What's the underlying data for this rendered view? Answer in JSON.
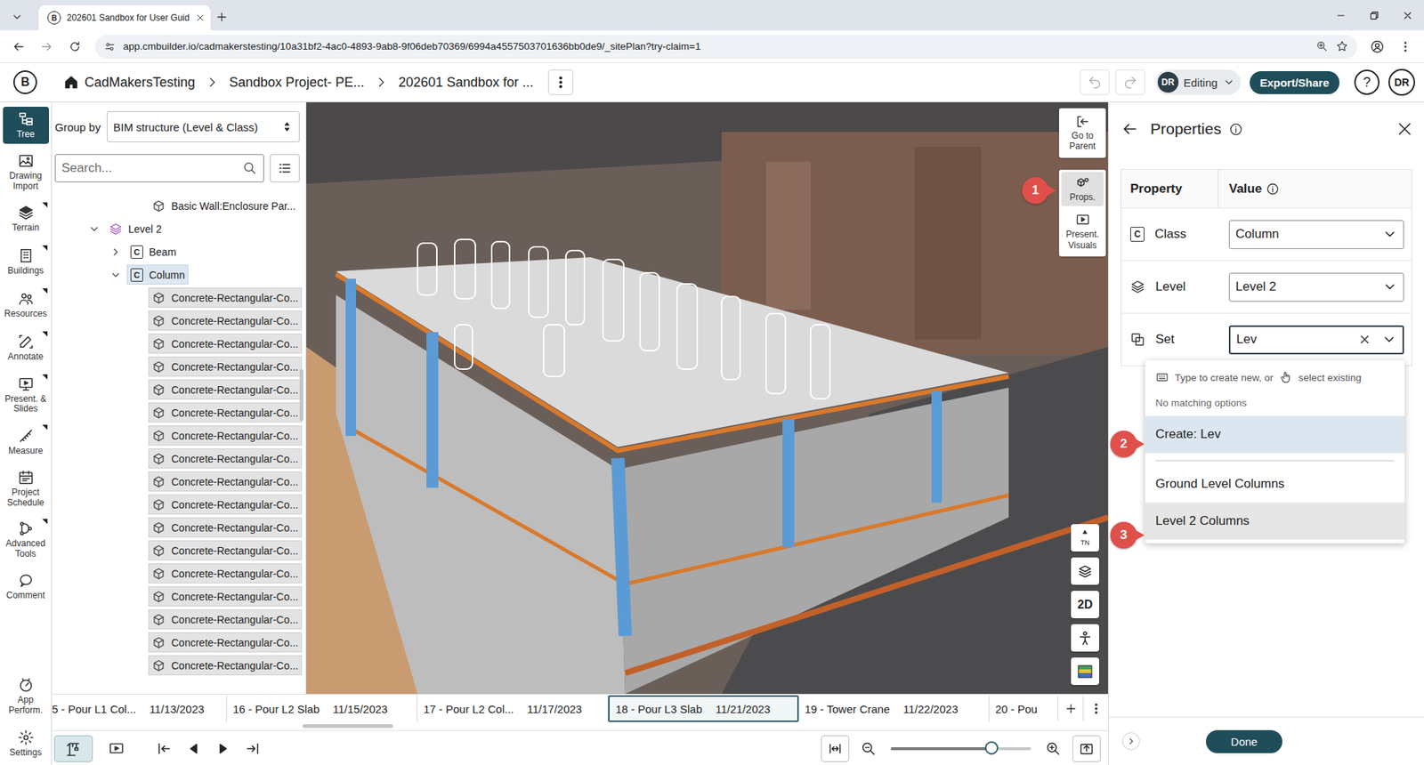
{
  "browser": {
    "favicon": "B",
    "tab_title": "202601 Sandbox for User Guid",
    "url": "app.cmbuilder.io/cadmakerstesting/10a31bf2-4ac0-4893-9ab8-9f06deb70369/6994a4557503701636bb0de9/_sitePlan?try-claim=1"
  },
  "header": {
    "logo": "B",
    "breadcrumbs": [
      "CadMakersTesting",
      "Sandbox Project- PE...",
      "202601 Sandbox for ..."
    ],
    "mode_avatar": "DR",
    "mode": "Editing",
    "export": "Export/Share",
    "help": "?",
    "user": "DR"
  },
  "rail": {
    "items": [
      {
        "label": "Tree",
        "selected": true,
        "flyout": false
      },
      {
        "label": "Drawing Import",
        "selected": false,
        "flyout": false
      },
      {
        "label": "Terrain",
        "selected": false,
        "flyout": true
      },
      {
        "label": "Buildings",
        "selected": false,
        "flyout": true
      },
      {
        "label": "Resources",
        "selected": false,
        "flyout": true
      },
      {
        "label": "Annotate",
        "selected": false,
        "flyout": true
      },
      {
        "label": "Present. & Slides",
        "selected": false,
        "flyout": true
      },
      {
        "label": "Measure",
        "selected": false,
        "flyout": true
      },
      {
        "label": "Project Schedule",
        "selected": false,
        "flyout": false
      },
      {
        "label": "Advanced Tools",
        "selected": false,
        "flyout": true
      },
      {
        "label": "Comment",
        "selected": false,
        "flyout": false
      }
    ],
    "footer_items": [
      {
        "label": "App Perform.",
        "selected": false,
        "flyout": false
      },
      {
        "label": "Settings",
        "selected": false,
        "flyout": false
      }
    ]
  },
  "tree": {
    "group_by_label": "Group by",
    "group_by_value": "BIM structure (Level & Class)",
    "search_placeholder": "Search...",
    "rows": [
      {
        "label": "Basic Wall:Enclosure Par...",
        "kind": "element",
        "badge": "",
        "depth": 2,
        "expandable": false,
        "expanded": false,
        "selected": false,
        "highlighted": false
      },
      {
        "label": "Level 2",
        "kind": "level",
        "badge": "",
        "depth": 0,
        "expandable": true,
        "expanded": true,
        "selected": false,
        "highlighted": false
      },
      {
        "label": "Beam",
        "kind": "class",
        "badge": "C",
        "depth": 1,
        "expandable": true,
        "expanded": false,
        "selected": false,
        "highlighted": false
      },
      {
        "label": "Column",
        "kind": "class",
        "badge": "C",
        "depth": 1,
        "expandable": true,
        "expanded": true,
        "selected": true,
        "highlighted": false
      },
      {
        "label": "Concrete-Rectangular-Co...",
        "kind": "element",
        "badge": "",
        "depth": 2,
        "expandable": false,
        "expanded": false,
        "selected": false,
        "highlighted": true
      },
      {
        "label": "Concrete-Rectangular-Co...",
        "kind": "element",
        "badge": "",
        "depth": 2,
        "expandable": false,
        "expanded": false,
        "selected": false,
        "highlighted": true
      },
      {
        "label": "Concrete-Rectangular-Co...",
        "kind": "element",
        "badge": "",
        "depth": 2,
        "expandable": false,
        "expanded": false,
        "selected": false,
        "highlighted": true
      },
      {
        "label": "Concrete-Rectangular-Co...",
        "kind": "element",
        "badge": "",
        "depth": 2,
        "expandable": false,
        "expanded": false,
        "selected": false,
        "highlighted": true
      },
      {
        "label": "Concrete-Rectangular-Co...",
        "kind": "element",
        "badge": "",
        "depth": 2,
        "expandable": false,
        "expanded": false,
        "selected": false,
        "highlighted": true
      },
      {
        "label": "Concrete-Rectangular-Co...",
        "kind": "element",
        "badge": "",
        "depth": 2,
        "expandable": false,
        "expanded": false,
        "selected": false,
        "highlighted": true
      },
      {
        "label": "Concrete-Rectangular-Co...",
        "kind": "element",
        "badge": "",
        "depth": 2,
        "expandable": false,
        "expanded": false,
        "selected": false,
        "highlighted": true
      },
      {
        "label": "Concrete-Rectangular-Co...",
        "kind": "element",
        "badge": "",
        "depth": 2,
        "expandable": false,
        "expanded": false,
        "selected": false,
        "highlighted": true
      },
      {
        "label": "Concrete-Rectangular-Co...",
        "kind": "element",
        "badge": "",
        "depth": 2,
        "expandable": false,
        "expanded": false,
        "selected": false,
        "highlighted": true
      },
      {
        "label": "Concrete-Rectangular-Co...",
        "kind": "element",
        "badge": "",
        "depth": 2,
        "expandable": false,
        "expanded": false,
        "selected": false,
        "highlighted": true
      },
      {
        "label": "Concrete-Rectangular-Co...",
        "kind": "element",
        "badge": "",
        "depth": 2,
        "expandable": false,
        "expanded": false,
        "selected": false,
        "highlighted": true
      },
      {
        "label": "Concrete-Rectangular-Co...",
        "kind": "element",
        "badge": "",
        "depth": 2,
        "expandable": false,
        "expanded": false,
        "selected": false,
        "highlighted": true
      },
      {
        "label": "Concrete-Rectangular-Co...",
        "kind": "element",
        "badge": "",
        "depth": 2,
        "expandable": false,
        "expanded": false,
        "selected": false,
        "highlighted": true
      },
      {
        "label": "Concrete-Rectangular-Co...",
        "kind": "element",
        "badge": "",
        "depth": 2,
        "expandable": false,
        "expanded": false,
        "selected": false,
        "highlighted": true
      },
      {
        "label": "Concrete-Rectangular-Co...",
        "kind": "element",
        "badge": "",
        "depth": 2,
        "expandable": false,
        "expanded": false,
        "selected": false,
        "highlighted": true
      },
      {
        "label": "Concrete-Rectangular-Co...",
        "kind": "element",
        "badge": "",
        "depth": 2,
        "expandable": false,
        "expanded": false,
        "selected": false,
        "highlighted": true
      },
      {
        "label": "Concrete-Rectangular-Co...",
        "kind": "element",
        "badge": "",
        "depth": 2,
        "expandable": false,
        "expanded": false,
        "selected": false,
        "highlighted": true
      }
    ]
  },
  "viewport": {
    "toolbar": [
      {
        "label": "Go to Parent",
        "selected": false
      },
      {
        "label": "Props.",
        "selected": true
      },
      {
        "label": "Present. Visuals",
        "selected": false
      }
    ],
    "view_tools": [
      {
        "kind": "compass",
        "label": "TN"
      },
      {
        "kind": "layers",
        "label": ""
      },
      {
        "kind": "text",
        "label": "2D"
      },
      {
        "kind": "person",
        "label": ""
      },
      {
        "kind": "palette",
        "label": ""
      }
    ]
  },
  "badges": [
    "1",
    "2",
    "3"
  ],
  "timeline": {
    "items": [
      {
        "name": "5 - Pour L1 Col...",
        "date": "11/13/2023",
        "selected": false
      },
      {
        "name": "16 - Pour L2 Slab",
        "date": "11/15/2023",
        "selected": false
      },
      {
        "name": "17 - Pour L2 Col...",
        "date": "11/17/2023",
        "selected": false
      },
      {
        "name": "18 - Pour L3 Slab",
        "date": "11/21/2023",
        "selected": true
      },
      {
        "name": "19 - Tower Crane",
        "date": "11/22/2023",
        "selected": false
      },
      {
        "name": "20 - Pou",
        "date": "",
        "selected": false
      }
    ]
  },
  "bottom_bar": {
    "view_modes": [
      {
        "selected": true
      },
      {
        "selected": false
      }
    ],
    "zoom_level": 0.72
  },
  "properties": {
    "title": "Properties",
    "columns": [
      "Property",
      "Value"
    ],
    "rows": [
      {
        "name": "Class",
        "badge": "C",
        "value": "Column",
        "kind": "select"
      },
      {
        "name": "Level",
        "badge": "",
        "value": "Level 2",
        "kind": "select"
      },
      {
        "name": "Set",
        "badge": "",
        "value": "Lev",
        "kind": "input"
      }
    ],
    "dropdown": {
      "hint_left": "Type to create new, or",
      "hint_right": "select existing",
      "empty": "No matching options",
      "create": {
        "label": "Create: Lev",
        "highlighted": true
      },
      "options": [
        {
          "label": "Ground Level Columns",
          "highlighted": false
        },
        {
          "label": "Level 2 Columns",
          "highlighted": true
        }
      ]
    },
    "done": "Done"
  }
}
